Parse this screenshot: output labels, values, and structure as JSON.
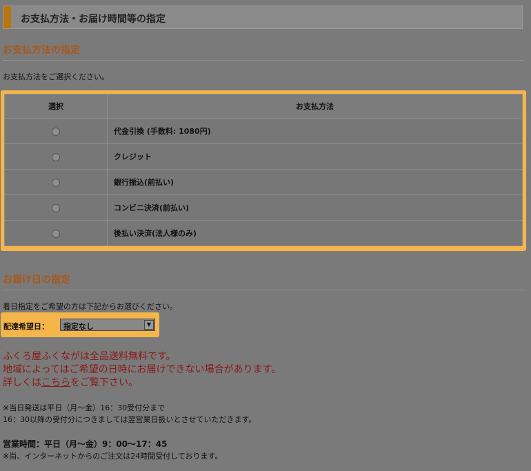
{
  "header": {
    "title": "お支払方法・お届け時間等の指定"
  },
  "payment": {
    "section_title": "お支払方法の指定",
    "instruction": "お支払方法をご選択ください。",
    "table": {
      "col_select": "選択",
      "col_method": "お支払方法",
      "rows": [
        {
          "label": "代金引換 (手数料: 1080円)"
        },
        {
          "label": "クレジット"
        },
        {
          "label": "銀行振込(前払い)"
        },
        {
          "label": "コンビニ決済(前払い)"
        },
        {
          "label": "後払い決済(法人様のみ)"
        }
      ]
    }
  },
  "delivery": {
    "section_title": "お届け日の指定",
    "instruction": "着日指定をご希望の方は下記からお選びください。",
    "date_label": "配達希望日：",
    "date_value": "指定なし"
  },
  "notice": {
    "line1": "ふくろ屋ふくながは全品送料無料です。",
    "line2": "地域によってはご希望の日時にお届けできない場合があります。",
    "line3_pre": "詳しくは",
    "line3_link": "こちら",
    "line3_post": "をご覧下さい。"
  },
  "shipping_note": {
    "line1": "※当日発送は平日（月～金）16：30受付分まで",
    "line2": "16：30以降の受付分につきましては翌営業日扱いとさせていただきます。"
  },
  "hours": {
    "line1": "営業時間：平日（月～金）9：00～17：45",
    "line2": "※尚、インターネットからのご注文は24時間受付しております。"
  }
}
